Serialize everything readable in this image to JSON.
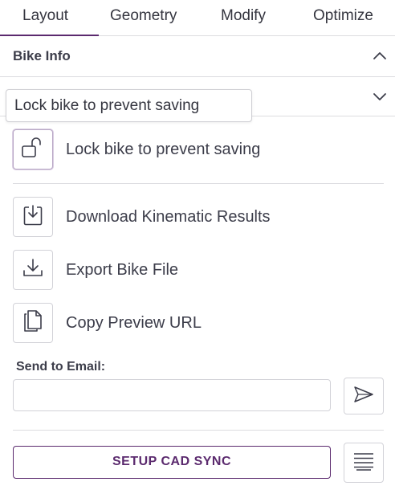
{
  "tabs": [
    {
      "label": "Layout",
      "active": true
    },
    {
      "label": "Geometry",
      "active": false
    },
    {
      "label": "Modify",
      "active": false
    },
    {
      "label": "Optimize",
      "active": false
    }
  ],
  "sections": {
    "bike_info": {
      "title": "Bike Info",
      "expanded": true
    }
  },
  "tooltip": {
    "text": "Lock bike to prevent saving"
  },
  "actions": {
    "lock": {
      "label": "Lock bike to prevent saving",
      "icon": "unlock-icon"
    },
    "download": {
      "label": "Download Kinematic Results",
      "icon": "download-box-icon"
    },
    "export": {
      "label": "Export Bike File",
      "icon": "download-icon"
    },
    "copy": {
      "label": "Copy Preview URL",
      "icon": "copy-icon"
    }
  },
  "email": {
    "label": "Send to Email:",
    "value": "",
    "placeholder": ""
  },
  "cad": {
    "label": "SETUP CAD SYNC"
  },
  "colors": {
    "accent": "#5b2a6e",
    "border": "#d2d2d8",
    "text": "#3c3d4a"
  }
}
